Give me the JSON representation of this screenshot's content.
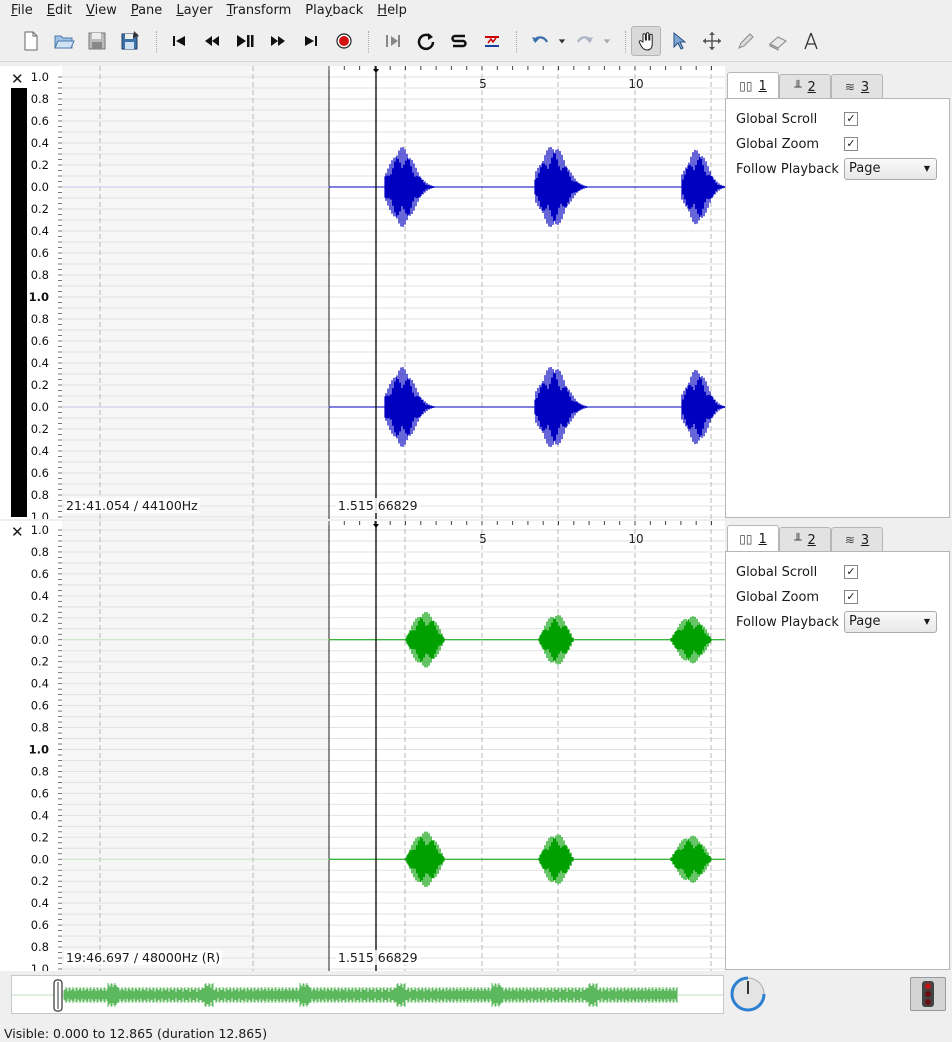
{
  "menu": [
    "File",
    "Edit",
    "View",
    "Pane",
    "Layer",
    "Transform",
    "Playback",
    "Help"
  ],
  "menu_mnemonics": [
    "F",
    "E",
    "V",
    "P",
    "L",
    "T",
    "y",
    "H"
  ],
  "toolbar": {
    "items": [
      "new-file-icon",
      "open-file-icon",
      "save-icon",
      "save-as-icon",
      "rewind-start-icon",
      "rewind-icon",
      "play-pause-icon",
      "fast-forward-icon",
      "fast-forward-end-icon",
      "record-icon",
      "constrain-playback-icon",
      "loop-icon",
      "solo-icon",
      "align-icon",
      "undo-icon",
      "redo-icon",
      "navigate-icon",
      "select-icon",
      "move-icon",
      "draw-icon",
      "erase-icon",
      "measure-icon"
    ],
    "active": "navigate-icon"
  },
  "panes": [
    {
      "scale_labels": [
        "1.0",
        "0.8",
        "0.6",
        "0.4",
        "0.2",
        "0.0",
        "0.2",
        "0.4",
        "0.6",
        "0.8",
        "1.0",
        "0.8",
        "0.6",
        "0.4",
        "0.2",
        "0.0",
        "0.2",
        "0.4",
        "0.6",
        "0.8",
        "1.0"
      ],
      "time_ruler_labels": [
        "5",
        "10"
      ],
      "readout_left": "21:41.054 / 44100Hz",
      "readout_right": "1.515  66829",
      "waveform_color": "#0000c0",
      "props": {
        "tabs": [
          "1",
          "2",
          "3"
        ],
        "global_scroll_label": "Global Scroll",
        "global_scroll": true,
        "global_zoom_label": "Global Zoom",
        "global_zoom": true,
        "follow_playback_label": "Follow Playback",
        "follow_playback": "Page"
      }
    },
    {
      "scale_labels": [
        "1.0",
        "0.8",
        "0.6",
        "0.4",
        "0.2",
        "0.0",
        "0.2",
        "0.4",
        "0.6",
        "0.8",
        "1.0",
        "0.8",
        "0.6",
        "0.4",
        "0.2",
        "0.0",
        "0.2",
        "0.4",
        "0.6",
        "0.8",
        "1.0"
      ],
      "time_ruler_labels": [
        "5",
        "10"
      ],
      "readout_left": "19:46.697 / 48000Hz (R)",
      "readout_right": "1.515  66829",
      "waveform_color": "#00a000",
      "props": {
        "tabs": [
          "1",
          "2",
          "3"
        ],
        "global_scroll_label": "Global Scroll",
        "global_scroll": true,
        "global_zoom_label": "Global Zoom",
        "global_zoom": true,
        "follow_playback_label": "Follow Playback",
        "follow_playback": "Page"
      }
    }
  ],
  "overview_color": "#5cb85c",
  "status": "Visible: 0.000 to 12.865 (duration 12.865)"
}
